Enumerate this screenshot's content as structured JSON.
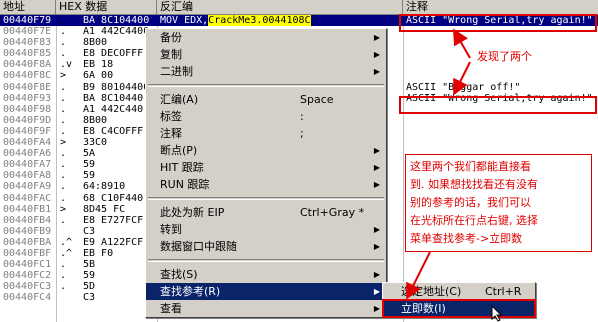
{
  "headers": [
    "地址",
    "HEX 数据",
    "反汇编",
    "注释"
  ],
  "rows": [
    {
      "addr": "00440F79",
      "mark": ".",
      "hex": "BA 8C104400",
      "dis_pre": "MOV EDX,",
      "dis_hl": "CrackMe3.0044108C",
      "cmt": "ASCII \"Wrong Serial,try again!\"",
      "sel": true
    },
    {
      "addr": "00440F7E",
      "mark": ".",
      "hex": "A1 442C4400",
      "dis_pre": "",
      "dis_hl": "",
      "cmt": ""
    },
    {
      "addr": "00440F83",
      "mark": ".",
      "hex": "8B00",
      "dis_pre": "",
      "dis_hl": "",
      "cmt": ""
    },
    {
      "addr": "00440F85",
      "mark": ".",
      "hex": "E8 DECOFFF",
      "dis_pre": "",
      "dis_hl": "",
      "cmt": ""
    },
    {
      "addr": "00440F8A",
      "mark": ".v",
      "hex": "EB 18",
      "dis_pre": "",
      "dis_hl": "",
      "cmt": ""
    },
    {
      "addr": "00440F8C",
      "mark": ">",
      "hex": "6A 00",
      "dis_pre": "",
      "dis_hl": "",
      "cmt": ""
    },
    {
      "addr": "00440F8E",
      "mark": ".",
      "hex": "B9 80104400",
      "dis_pre": "",
      "dis_hl": "",
      "cmt": "ASCII \"Beggar off!\""
    },
    {
      "addr": "00440F93",
      "mark": ".",
      "hex": "BA 8C10440",
      "dis_pre": "",
      "dis_hl": "",
      "cmt": "ASCII \"Wrong Serial,try again!\""
    },
    {
      "addr": "00440F98",
      "mark": ".",
      "hex": "A1 442C440",
      "dis_pre": "",
      "dis_hl": "",
      "cmt": ""
    },
    {
      "addr": "00440F9D",
      "mark": ".",
      "hex": "8B00",
      "dis_pre": "",
      "dis_hl": "",
      "cmt": ""
    },
    {
      "addr": "00440F9F",
      "mark": ".",
      "hex": "E8 C4COFFF",
      "dis_pre": "",
      "dis_hl": "",
      "cmt": ""
    },
    {
      "addr": "00440FA4",
      "mark": ">",
      "hex": "33C0",
      "dis_pre": "",
      "dis_hl": "",
      "cmt": ""
    },
    {
      "addr": "00440FA6",
      "mark": ".",
      "hex": "5A",
      "dis_pre": "",
      "dis_hl": "",
      "cmt": ""
    },
    {
      "addr": "00440FA7",
      "mark": ".",
      "hex": "59",
      "dis_pre": "",
      "dis_hl": "",
      "cmt": ""
    },
    {
      "addr": "00440FA8",
      "mark": ".",
      "hex": "59",
      "dis_pre": "",
      "dis_hl": "",
      "cmt": ""
    },
    {
      "addr": "00440FA9",
      "mark": ".",
      "hex": "64:8910",
      "dis_pre": "",
      "dis_hl": "",
      "cmt": ""
    },
    {
      "addr": "00440FAC",
      "mark": ".",
      "hex": "68 C10F440",
      "dis_pre": "",
      "dis_hl": "",
      "cmt": ""
    },
    {
      "addr": "00440FB1",
      "mark": ">",
      "hex": "8D45 FC",
      "dis_pre": "",
      "dis_hl": "",
      "cmt": ""
    },
    {
      "addr": "00440FB4",
      "mark": ".",
      "hex": "E8 E727FCF",
      "dis_pre": "",
      "dis_hl": "",
      "cmt": ""
    },
    {
      "addr": "00440FB9",
      "mark": "",
      "hex": "C3",
      "dis_pre": "",
      "dis_hl": "",
      "cmt": ""
    },
    {
      "addr": "00440FBA",
      "mark": ".^",
      "hex": "E9 A122FCF",
      "dis_pre": "",
      "dis_hl": "",
      "cmt": ""
    },
    {
      "addr": "00440FBF",
      "mark": ".^",
      "hex": "EB F0",
      "dis_pre": "",
      "dis_hl": "",
      "cmt": ""
    },
    {
      "addr": "00440FC1",
      "mark": ".",
      "hex": "5B",
      "dis_pre": "",
      "dis_hl": "",
      "cmt": ""
    },
    {
      "addr": "00440FC2",
      "mark": ".",
      "hex": "59",
      "dis_pre": "",
      "dis_hl": "",
      "cmt": ""
    },
    {
      "addr": "00440FC3",
      "mark": ".",
      "hex": "5D",
      "dis_pre": "",
      "dis_hl": "",
      "cmt": ""
    },
    {
      "addr": "00440FC4",
      "mark": "",
      "hex": "C3",
      "dis_pre": "",
      "dis_hl": "",
      "cmt": ""
    }
  ],
  "menu": [
    {
      "label": "备份",
      "shortcut": "",
      "arrow": true
    },
    {
      "label": "复制",
      "shortcut": "",
      "arrow": true
    },
    {
      "label": "二进制",
      "shortcut": "",
      "arrow": true
    },
    {
      "sep": true
    },
    {
      "label": "汇编(A)",
      "shortcut": "Space",
      "arrow": false
    },
    {
      "label": "标签",
      "shortcut": ":",
      "arrow": false
    },
    {
      "label": "注释",
      "shortcut": ";",
      "arrow": false
    },
    {
      "label": "断点(P)",
      "shortcut": "",
      "arrow": true
    },
    {
      "label": "HIT 跟踪",
      "shortcut": "",
      "arrow": true
    },
    {
      "label": "RUN 跟踪",
      "shortcut": "",
      "arrow": true
    },
    {
      "sep": true
    },
    {
      "label": "此处为新 EIP",
      "shortcut": "Ctrl+Gray *",
      "arrow": false
    },
    {
      "label": "转到",
      "shortcut": "",
      "arrow": true
    },
    {
      "label": "数据窗口中跟随",
      "shortcut": "",
      "arrow": true
    },
    {
      "sep": true
    },
    {
      "label": "查找(S)",
      "shortcut": "",
      "arrow": true
    },
    {
      "label": "查找参考(R)",
      "shortcut": "",
      "arrow": true,
      "active": true
    },
    {
      "label": "查看",
      "shortcut": "",
      "arrow": true
    }
  ],
  "submenu": [
    {
      "label": "选定地址(C)",
      "shortcut": "Ctrl+R"
    },
    {
      "label": "立即数(I)",
      "shortcut": "",
      "active": true
    }
  ],
  "annotations": {
    "found_two": "发现了两个",
    "note_lines": [
      "这里两个我们都能直接看",
      "到. 如果想找找看还有没有",
      "别的参考的话，我们可以",
      "在光标所在行点右键, 选择",
      "菜单查找参考->立即数"
    ]
  },
  "colors": {
    "highlight": "#ffff00",
    "selection": "#000080",
    "menu_active": "#0a246a",
    "annotation": "#e00000"
  }
}
